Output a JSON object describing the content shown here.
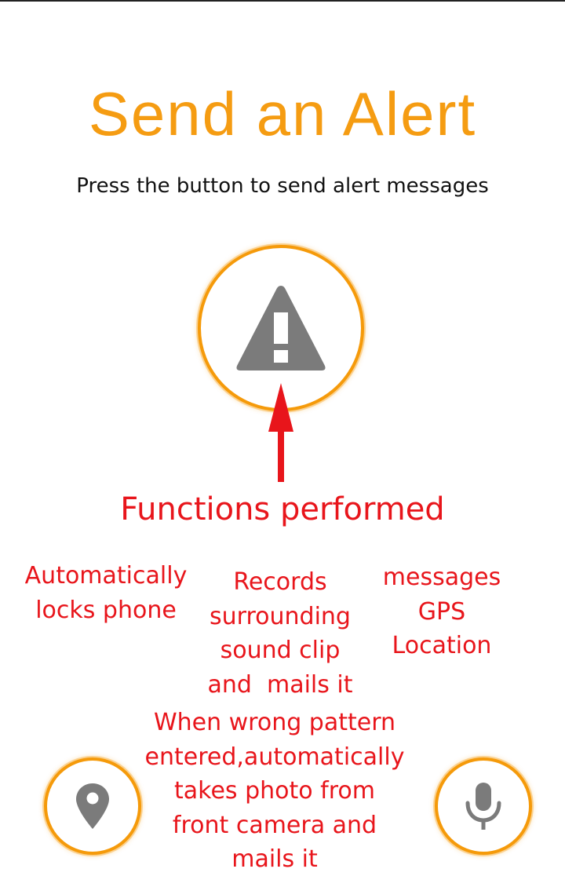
{
  "screen": {
    "title": "Send an Alert",
    "subtitle": "Press the button to send alert messages"
  },
  "buttons": {
    "alert": {
      "icon": "warning-triangle-icon"
    },
    "location": {
      "icon": "location-pin-icon"
    },
    "microphone": {
      "icon": "microphone-icon"
    }
  },
  "annotations": {
    "heading": "Functions performed",
    "auto_lock": [
      "Automatically",
      "locks phone"
    ],
    "records": [
      "Records",
      "surrounding",
      "sound clip",
      "and  mails it"
    ],
    "messages": [
      "messages",
      "GPS",
      "Location"
    ],
    "wrong_pattern": [
      "When wrong pattern",
      "entered,automatically",
      "takes photo from",
      "front camera and",
      "mails it"
    ]
  },
  "colors": {
    "accent": "#f59c12",
    "icon_gray": "#7b7b7b",
    "annotation_red": "#e8151b"
  }
}
